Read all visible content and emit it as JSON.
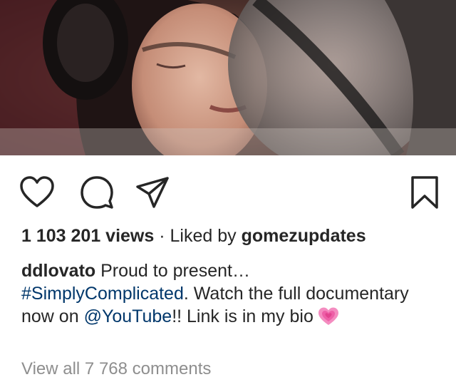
{
  "post": {
    "media": {
      "description_icon": "video-frame-image"
    },
    "actions": {
      "like_icon": "heart-icon",
      "comment_icon": "comment-icon",
      "share_icon": "send-icon",
      "save_icon": "bookmark-icon"
    },
    "stats": {
      "views": "1 103 201 views",
      "separator": "·",
      "liked_by_prefix": "Liked by",
      "liked_by_user": "gomezupdates"
    },
    "caption": {
      "username": "ddlovato",
      "text_1": "Proud to present…",
      "hashtag": "#SimplyComplicated",
      "text_2": ". Watch the full documentary now on ",
      "mention": "@YouTube",
      "text_3": "!! Link is in my bio",
      "emoji": "growing-heart-emoji"
    },
    "view_comments": "View all 7 768 comments"
  },
  "colors": {
    "link": "#00376b",
    "muted": "#8e8e8e",
    "text": "#262626",
    "emoji_pink": "#f26fb0"
  }
}
